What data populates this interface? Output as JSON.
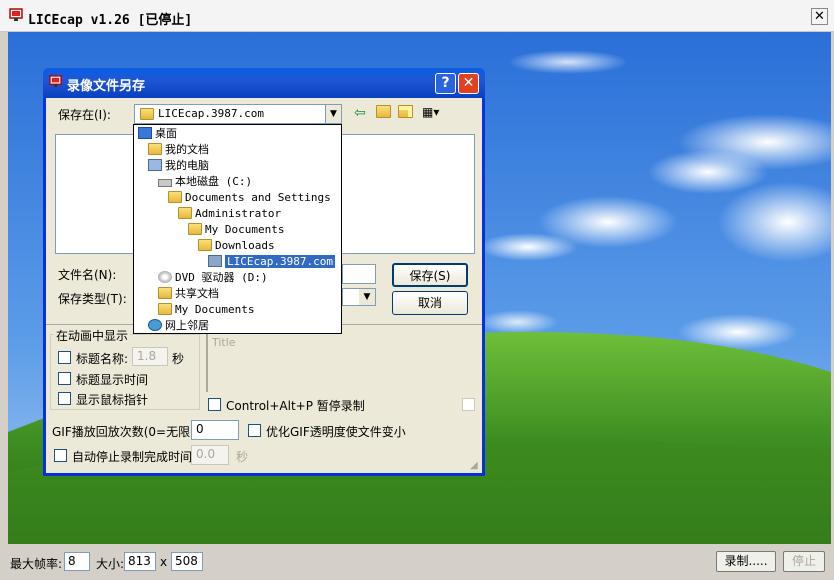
{
  "app": {
    "title": "LICEcap v1.26 [已停止]",
    "close_glyph": "✕"
  },
  "status_bar": {
    "max_fps_label": "最大帧率:",
    "max_fps_value": "8",
    "size_label": "大小:",
    "width": "813",
    "x_sep": "x",
    "height": "508",
    "record_button": "录制.....",
    "stop_button": "停止"
  },
  "dialog": {
    "title": "录像文件另存",
    "help_glyph": "?",
    "close_glyph": "✕",
    "save_in_label": "保存在(I):",
    "save_in_value": "LICEcap.3987.com",
    "filename_label": "文件名(N):",
    "filetype_label": "保存类型(T):",
    "save_button": "保存(S)",
    "cancel_button": "取消",
    "group_label": "在动画中显示",
    "title_name_label": "标题名称:",
    "title_name_value": "1.8",
    "seconds_unit": "秒",
    "show_title_time_label": "标题显示时间",
    "show_cursor_label": "显示鼠标指针",
    "title_placeholder": "Title",
    "ctrl_alt_p_label": "Control+Alt+P 暂停录制",
    "gif_repeat_label": "GIF播放回放次数(0=无限):",
    "gif_repeat_value": "0",
    "optimize_gif_label": "优化GIF透明度使文件变小",
    "auto_stop_label": "自动停止录制完成时间",
    "auto_stop_value": "0.0",
    "auto_stop_unit": "秒"
  },
  "dropdown": {
    "items": [
      {
        "label": "桌面",
        "icon": "desktop-icon"
      },
      {
        "label": "我的文档",
        "icon": "my-documents-icon"
      },
      {
        "label": "我的电脑",
        "icon": "my-computer-icon"
      },
      {
        "label": "本地磁盘 (C:)",
        "icon": "local-disk-icon"
      },
      {
        "label": "Documents and Settings",
        "icon": "folder-icon"
      },
      {
        "label": "Administrator",
        "icon": "folder-icon"
      },
      {
        "label": "My Documents",
        "icon": "folder-icon"
      },
      {
        "label": "Downloads",
        "icon": "folder-icon"
      },
      {
        "label": "LICEcap.3987.com",
        "icon": "folder-icon"
      },
      {
        "label": "DVD 驱动器 (D:)",
        "icon": "dvd-drive-icon"
      },
      {
        "label": "共享文档",
        "icon": "folder-icon"
      },
      {
        "label": "My Documents",
        "icon": "folder-icon"
      },
      {
        "label": "网上邻居",
        "icon": "network-icon"
      }
    ]
  },
  "colors": {
    "sky": "#3f82dd",
    "grass": "#4a9a2a",
    "title_blue": "#0831d9",
    "selection": "#316ac5"
  }
}
